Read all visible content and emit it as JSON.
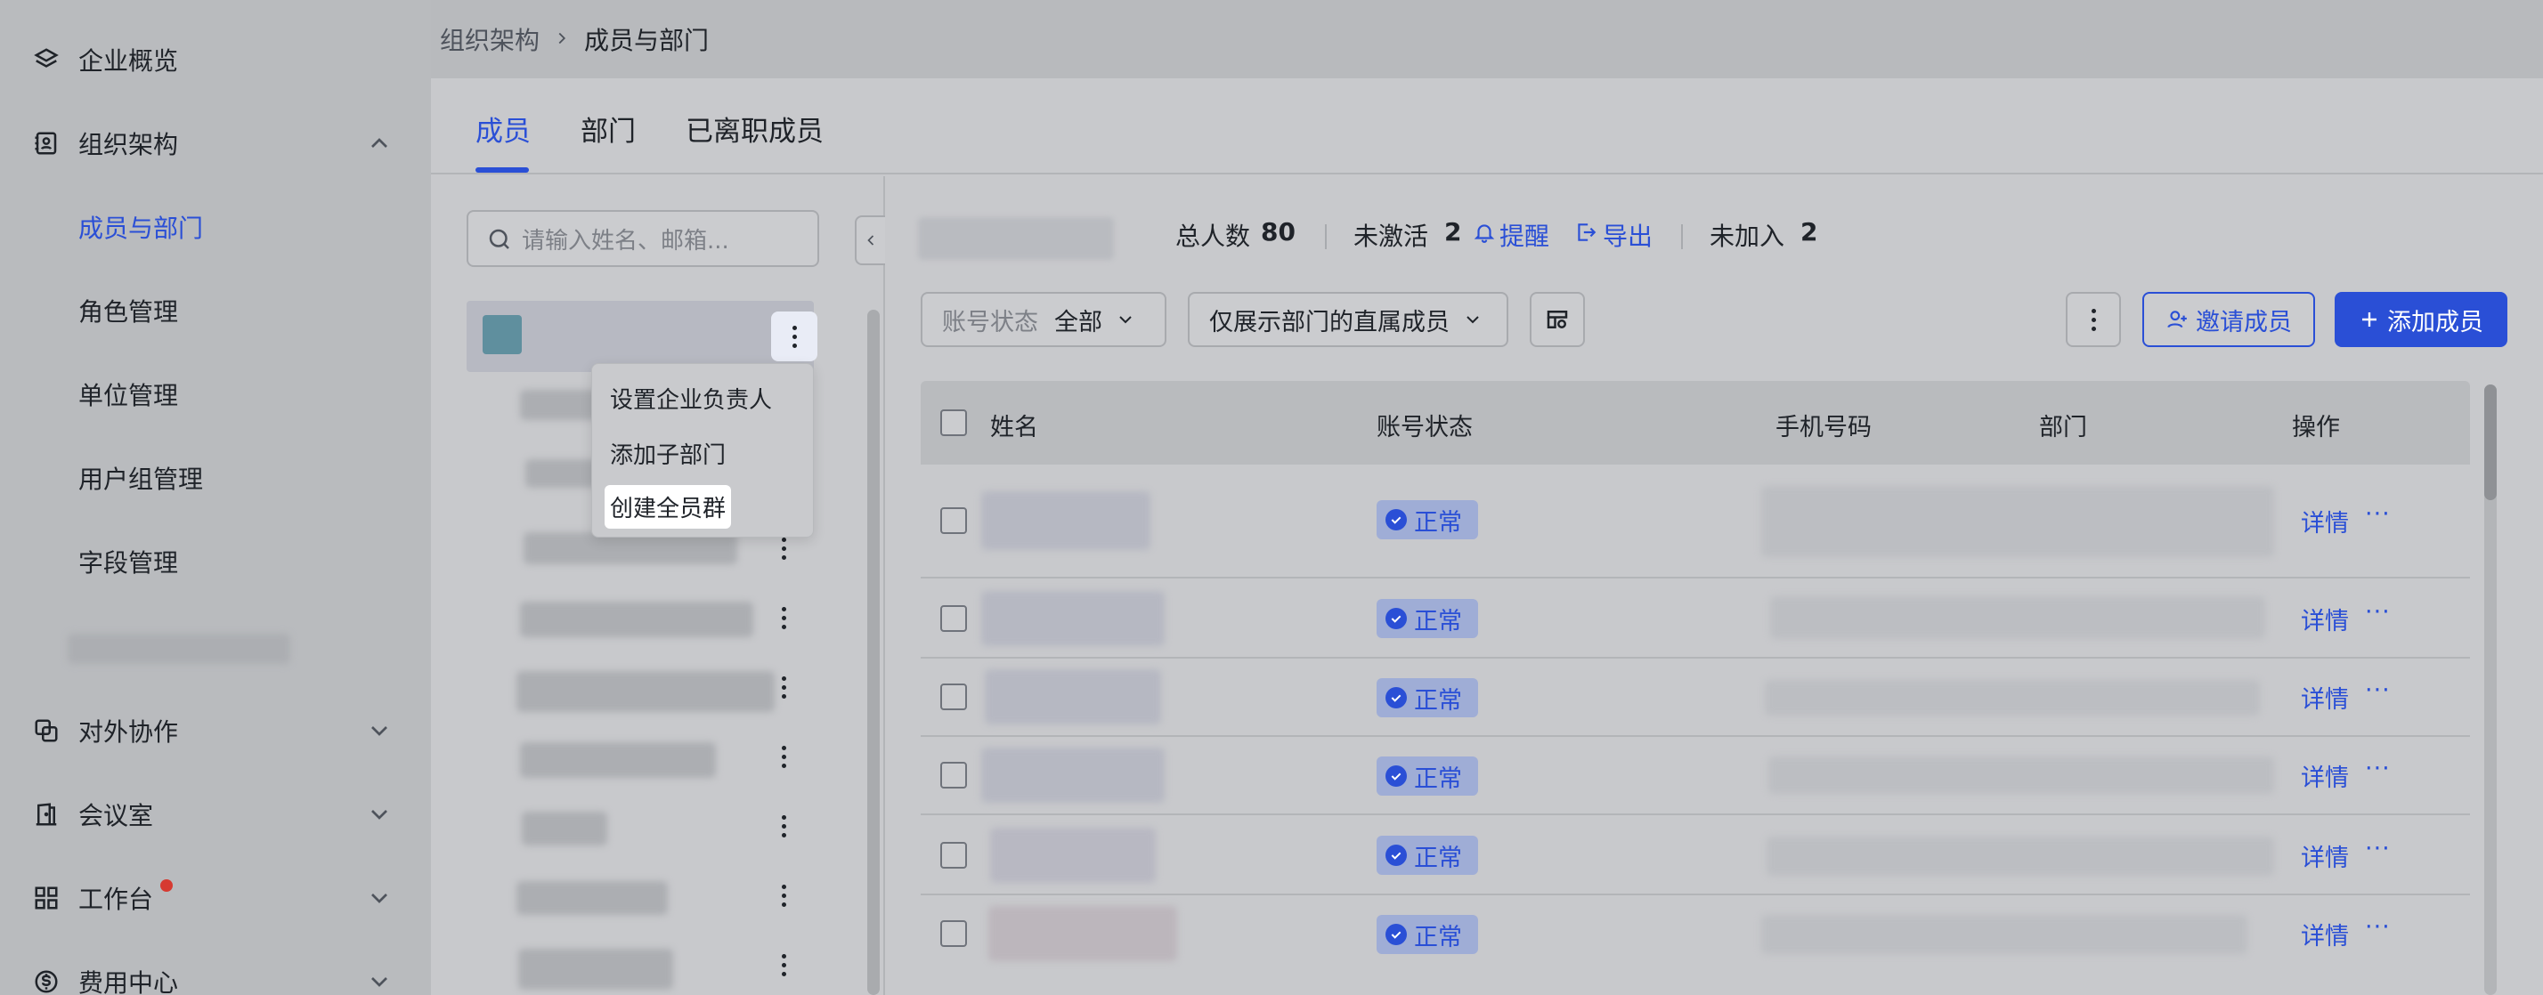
{
  "sidebar": {
    "items": [
      {
        "label": "企业概览",
        "icon": "layers-icon"
      },
      {
        "label": "组织架构",
        "icon": "org-icon",
        "expanded": true
      },
      {
        "label": "成员与部门",
        "active": true
      },
      {
        "label": "角色管理"
      },
      {
        "label": "单位管理"
      },
      {
        "label": "用户组管理"
      },
      {
        "label": "字段管理"
      },
      {
        "label": "对外协作",
        "icon": "collab-icon"
      },
      {
        "label": "会议室",
        "icon": "door-icon"
      },
      {
        "label": "工作台",
        "icon": "grid-icon",
        "dot": true
      },
      {
        "label": "费用中心",
        "icon": "dollar-icon"
      }
    ]
  },
  "breadcrumb": {
    "parent": "组织架构",
    "current": "成员与部门"
  },
  "tabs": [
    {
      "label": "成员",
      "active": true
    },
    {
      "label": "部门"
    },
    {
      "label": "已离职成员"
    }
  ],
  "dept_panel": {
    "search_placeholder": "请输入姓名、邮箱..."
  },
  "popup_menu": {
    "items": [
      "设置企业负责人",
      "添加子部门",
      "创建全员群"
    ]
  },
  "stats": {
    "total_label": "总人数",
    "total_value": "80",
    "inactive_label": "未激活",
    "inactive_value": "2",
    "remind_label": "提醒",
    "export_label": "导出",
    "not_joined_label": "未加入",
    "not_joined_value": "2"
  },
  "filters": {
    "status_label": "账号状态",
    "status_value": "全部",
    "scope_value": "仅展示部门的直属成员"
  },
  "buttons": {
    "invite": "邀请成员",
    "add": "添加成员"
  },
  "table": {
    "columns": [
      "姓名",
      "账号状态",
      "手机号码",
      "部门",
      "操作"
    ],
    "rows": [
      {
        "status": "正常",
        "action": "详情",
        "more": "···"
      },
      {
        "status": "正常",
        "action": "详情",
        "more": "···"
      },
      {
        "status": "正常",
        "action": "详情",
        "more": "···"
      },
      {
        "status": "正常",
        "action": "详情",
        "more": "···"
      },
      {
        "status": "正常",
        "action": "详情",
        "more": "···"
      },
      {
        "status": "正常",
        "action": "详情",
        "more": "···"
      }
    ]
  },
  "colors": {
    "accent": "#2a4fd6",
    "badge_dot": "#d63a31"
  }
}
